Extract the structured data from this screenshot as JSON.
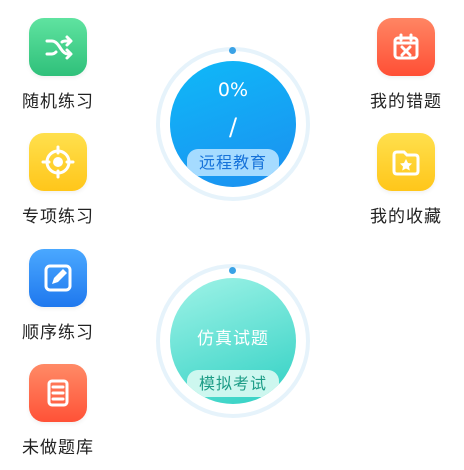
{
  "left_menu": [
    {
      "label": "随机练习",
      "icon": "shuffle-icon"
    },
    {
      "label": "专项练习",
      "icon": "target-icon"
    },
    {
      "label": "顺序练习",
      "icon": "pencil-icon"
    },
    {
      "label": "未做题库",
      "icon": "scroll-icon"
    }
  ],
  "right_menu": [
    {
      "label": "我的错题",
      "icon": "calendar-x-icon"
    },
    {
      "label": "我的收藏",
      "icon": "folder-star-icon"
    }
  ],
  "progress_circle": {
    "percent": "0%",
    "separator": "/",
    "pill_label": "远程教育"
  },
  "exam_circle": {
    "title": "仿真试题",
    "pill_label": "模拟考试"
  },
  "colors": {
    "green": "#4fd18b",
    "yellow": "#ffd21f",
    "blue": "#2b8ff3",
    "red": "#ff6a4a",
    "progress_blue": "#1b8ff0",
    "exam_teal": "#2fd0c3"
  }
}
